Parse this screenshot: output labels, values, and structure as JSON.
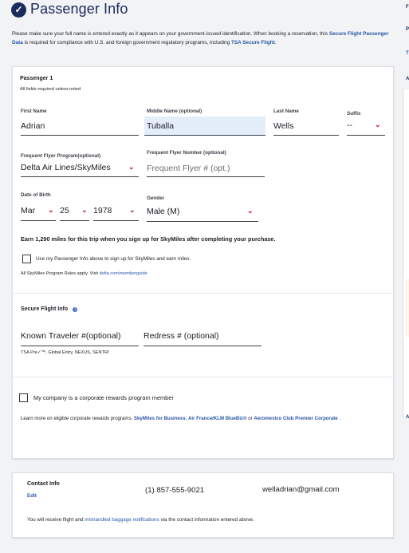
{
  "header": {
    "title": "Passenger Info",
    "intro_text_1": "Please make sure your full name is entered exactly as it appears on your government-issued identification. When booking a reservation, this ",
    "intro_link_1": "Secure Flight Passenger Data",
    "intro_text_2": " is required for compliance with U.S. and foreign government regulatory programs, including ",
    "intro_link_2": "TSA Secure Flight",
    "intro_text_3": "."
  },
  "passenger": {
    "heading": "Passenger 1",
    "required_note": "All fields required unless noted",
    "first_name": {
      "label": "First Name",
      "value": "Adrian"
    },
    "middle_name": {
      "label": "Middle Name (optional)",
      "value": "Tuballa"
    },
    "last_name": {
      "label": "Last Name",
      "value": "Wells"
    },
    "suffix": {
      "label": "Suffix",
      "value": "--"
    },
    "ff_program": {
      "label": "Frequent Flyer Program(optional)",
      "value": "Delta Air Lines/SkyMiles"
    },
    "ff_number": {
      "label": "Frequent Flyer Number (optional)",
      "placeholder": "Frequent Flyer # (opt.)"
    },
    "dob": {
      "label": "Date of Birth",
      "month": "Mar",
      "day": "25",
      "year": "1978"
    },
    "gender": {
      "label": "Gender",
      "value": "Male (M)"
    },
    "earn_miles": "Earn 1,290 miles for this trip when you sign up for SkyMiles after completing your purchase.",
    "signup_checkbox_label": "Use my Passenger Info above to sign up for SkyMiles and earn miles.",
    "rules_text": "All SkyMiles Program Rules apply. Visit ",
    "rules_link": "delta.com/memberguide"
  },
  "secure_flight": {
    "heading": "Secure Flight Info",
    "info_icon": "i",
    "known_traveler_placeholder": "Known Traveler #(optional)",
    "redress_placeholder": "Redress # (optional)",
    "programs_note": "TSA Pre✓™, Global Entry, NEXUS, SENTRI"
  },
  "corporate": {
    "checkbox_label": "My company is a corporate rewards program member",
    "text_1": "Learn more on eligible corporate rewards programs, ",
    "link_1": "SkyMiles for Business",
    "text_2": ", ",
    "link_2": "Air France/KLM BlueBiz®",
    "text_3": "  or ",
    "link_3": "Aeromexico Club Premier Corporate",
    "text_4": " ."
  },
  "contact": {
    "heading": "Contact Info",
    "edit_link": "Edit",
    "phone": "(1) 857-555-9021",
    "email": "welladrian@gmail.com",
    "notice_text_1": "You will receive flight and ",
    "notice_link": "mishandled baggage notifications",
    "notice_text_2": " via the contact information entered above."
  },
  "right_panel": {
    "letters": [
      "F",
      "P",
      "T",
      "A",
      "A"
    ]
  },
  "colors": {
    "brand_navy": "#1b2b5c",
    "link_blue": "#2a55a8",
    "chevron_red": "#c4142b",
    "highlight": "#e4eefb"
  }
}
